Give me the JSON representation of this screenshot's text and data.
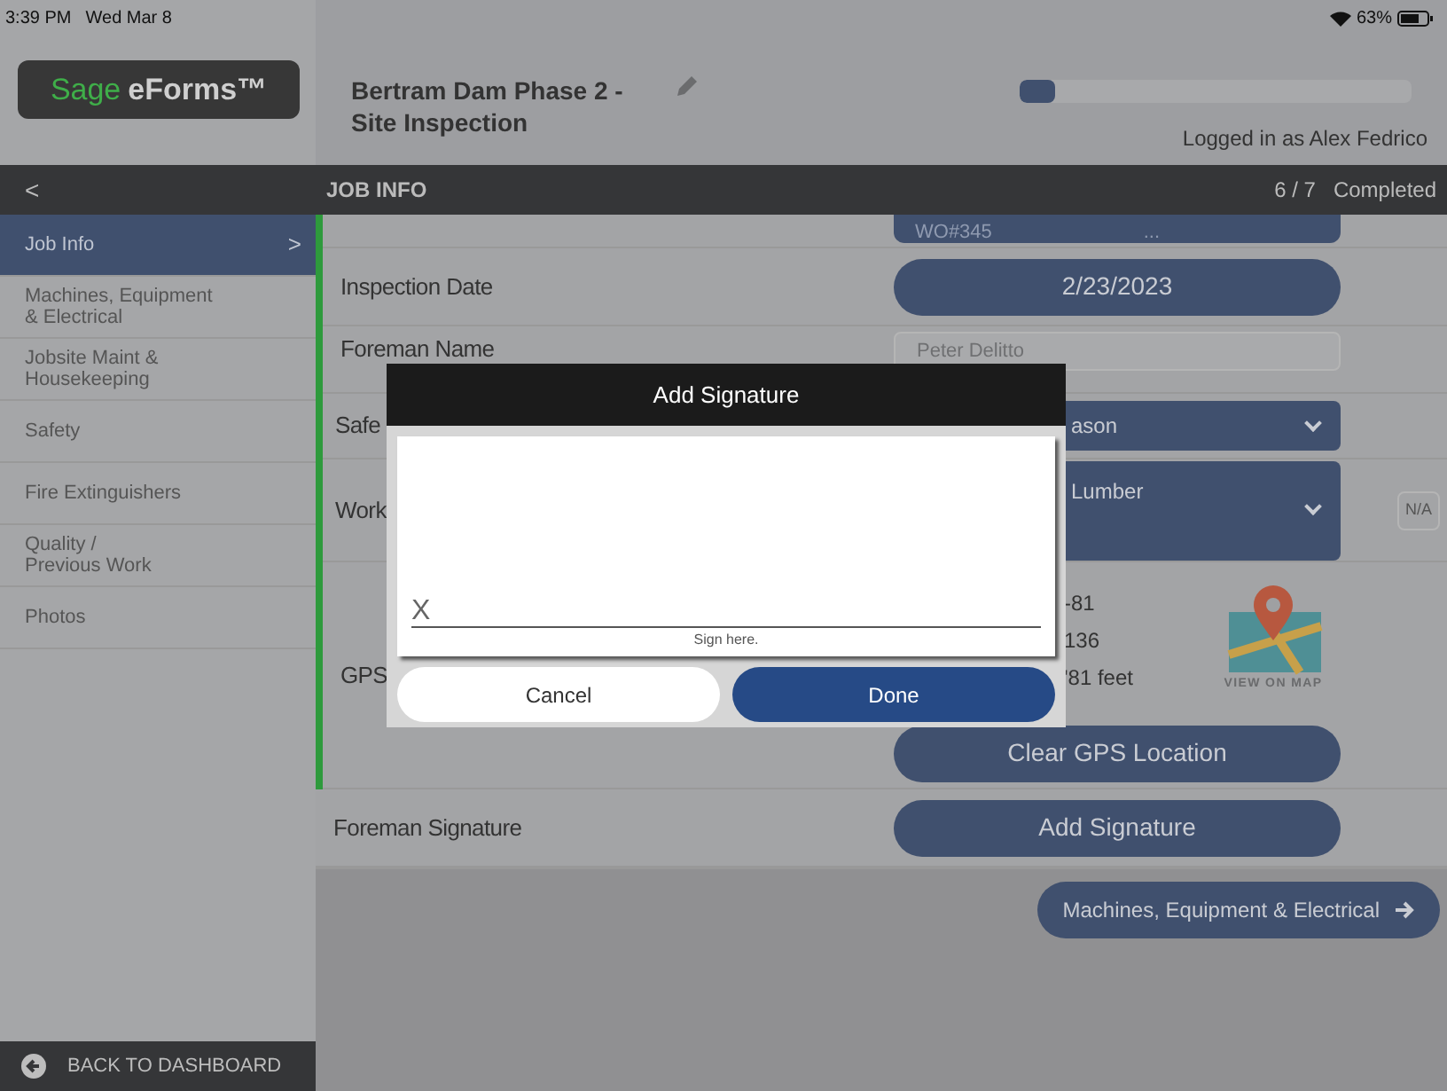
{
  "status_bar": {
    "time": "3:39 PM",
    "date": "Wed Mar 8",
    "battery": "63%"
  },
  "logo": {
    "brand": "Sage",
    "product": "eForms™"
  },
  "header": {
    "title": "Bertram Dam Phase 2 - Site Inspection",
    "progress": {
      "level": 0.09
    },
    "user": "Logged in as Alex Fedrico"
  },
  "section_bar": {
    "back": "<",
    "title": "JOB INFO",
    "count": "6 / 7",
    "status": "Completed"
  },
  "sidebar": {
    "items": [
      {
        "label": "Job Info",
        "selected": true,
        "arrow": ">"
      },
      {
        "label": "Machines, Equipment\n& Electrical",
        "selected": false
      },
      {
        "label": "Jobsite Maint &\nHousekeeping",
        "selected": false
      },
      {
        "label": "Safety",
        "selected": false
      },
      {
        "label": "Fire Extinguishers",
        "selected": false
      },
      {
        "label": "Quality /\nPrevious Work",
        "selected": false
      },
      {
        "label": "Photos",
        "selected": false
      }
    ],
    "footer": "BACK TO DASHBOARD"
  },
  "form": {
    "rows": [
      {
        "kind": "cut",
        "value": "WO#345",
        "extra": "..."
      },
      {
        "kind": "button",
        "label": "Inspection Date",
        "value": "2/23/2023"
      },
      {
        "kind": "input",
        "label": "Foreman Name",
        "placeholder": "Peter Delitto"
      },
      {
        "kind": "dropdown",
        "label": "Safe",
        "value": "ason"
      },
      {
        "kind": "dropdown",
        "label": "Work",
        "value": "Lumber",
        "na": "N/A"
      },
      {
        "kind": "gps",
        "label": "GPS",
        "lines": [
          "-81",
          "136",
          "'81 feet"
        ],
        "map": "VIEW ON MAP",
        "button": "Clear GPS Location"
      },
      {
        "kind": "button",
        "label": "Foreman Signature",
        "value": "Add Signature"
      }
    ],
    "next": "Machines, Equipment & Electrical"
  },
  "dialog": {
    "title": "Add Signature",
    "mark": "X",
    "hint": "Sign here.",
    "buttons": [
      {
        "label": "Cancel",
        "kind": "secondary"
      },
      {
        "label": "Done",
        "kind": "primary"
      }
    ]
  }
}
